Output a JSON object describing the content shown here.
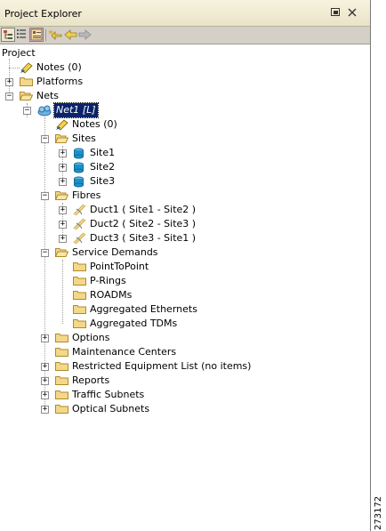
{
  "window": {
    "title": "Project Explorer",
    "figure_id": "273172"
  },
  "toolbar": {
    "buttons": [
      "tree-view-icon",
      "list-view-icon",
      "details-view-icon",
      "star-back-icon",
      "back-arrow-icon",
      "forward-arrow-icon"
    ]
  },
  "tree": {
    "root": "Project",
    "project_notes": "Notes (0)",
    "platforms": "Platforms",
    "nets": "Nets",
    "net1": "Net1 [L]",
    "net1_notes": "Notes (0)",
    "sites": "Sites",
    "site_items": [
      "Site1",
      "Site2",
      "Site3"
    ],
    "fibres": "Fibres",
    "fibre_items": [
      "Duct1 ( Site1 - Site2 )",
      "Duct2 ( Site2 - Site3 )",
      "Duct3 ( Site3 - Site1 )"
    ],
    "service_demands": "Service Demands",
    "demand_items": [
      "PointToPoint",
      "P-Rings",
      "ROADMs",
      "Aggregated Ethernets",
      "Aggregated TDMs"
    ],
    "options": "Options",
    "maintenance_centers": "Maintenance Centers",
    "restricted_list": "Restricted Equipment List (no items)",
    "reports": "Reports",
    "traffic_subnets": "Traffic Subnets",
    "optical_subnets": "Optical Subnets"
  },
  "colors": {
    "folder": "#f4d88a",
    "selection": "#0a246a",
    "site_cube": "#1e90c8"
  }
}
